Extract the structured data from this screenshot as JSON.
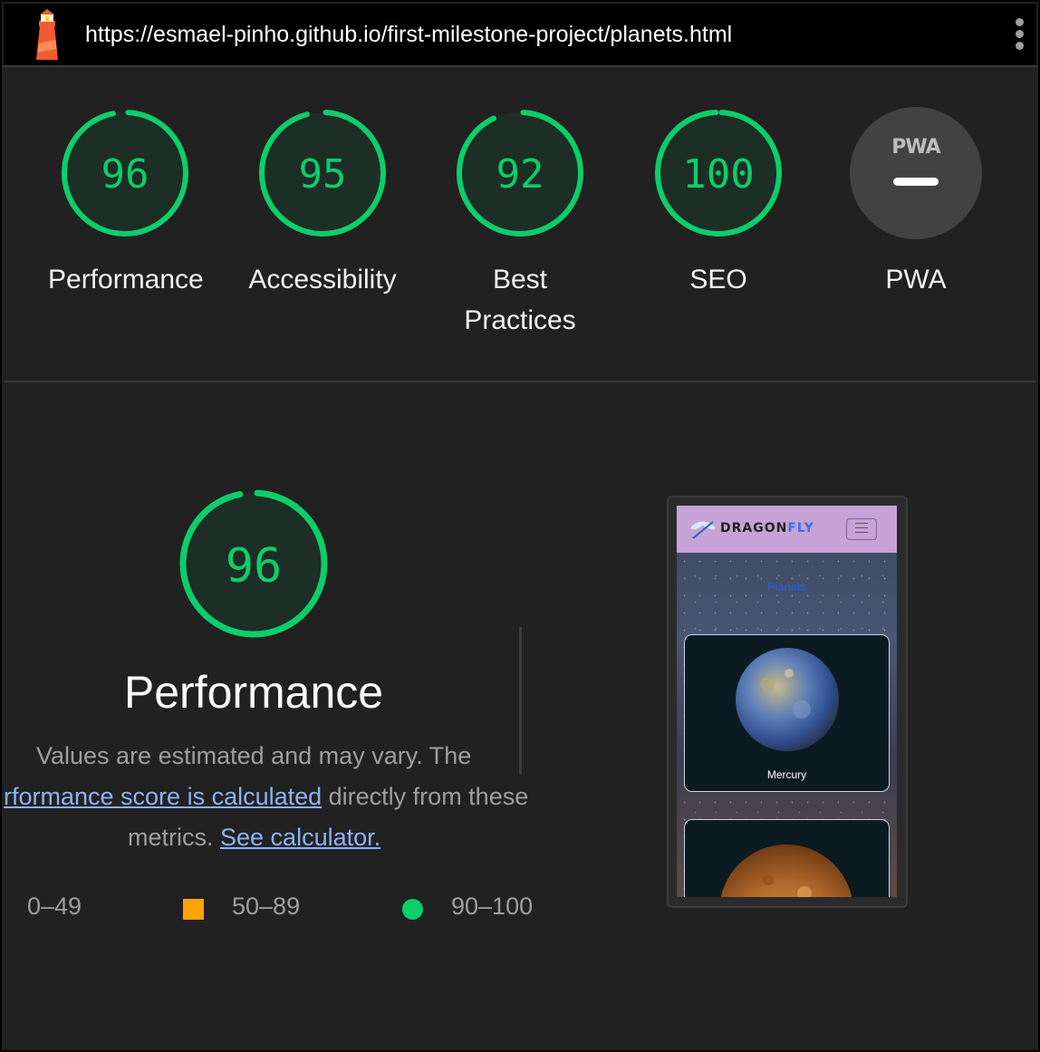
{
  "browser": {
    "url": "https://esmael-pinho.github.io/first-milestone-project/planets.html"
  },
  "scores": [
    {
      "label": "Performance",
      "value": "96",
      "fraction": 0.96
    },
    {
      "label": "Accessibility",
      "value": "95",
      "fraction": 0.95
    },
    {
      "label": "Best Practices",
      "label_line1": "Best",
      "label_line2": "Practices",
      "value": "92",
      "fraction": 0.92
    },
    {
      "label": "SEO",
      "value": "100",
      "fraction": 1.0
    },
    {
      "label": "PWA",
      "badge": "PWA",
      "value": "—"
    }
  ],
  "performance": {
    "score": "96",
    "fraction": 0.96,
    "title": "Performance",
    "desc_line1": "Values are estimated and may vary. The",
    "desc_link1": "rformance score is calculated",
    "desc_line2_tail": " directly from these",
    "desc_line3_head": "metrics. ",
    "desc_link2": "See calculator."
  },
  "legend": {
    "fail": "0–49",
    "average": "50–89",
    "pass": "90–100"
  },
  "thumbnail": {
    "brand_a": "DRAGON",
    "brand_b": "FLY",
    "page_title": "Planets",
    "card1_label": "Mercury"
  },
  "colors": {
    "pass": "#0cce6b",
    "average": "#ffa400",
    "fail": "#ff4e42",
    "background": "#212121"
  }
}
